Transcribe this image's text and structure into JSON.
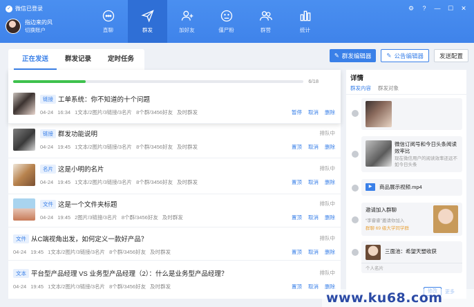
{
  "window": {
    "status": "微信已登录",
    "user_name": "指边来的风",
    "switch_account": "切换账户"
  },
  "nav": [
    {
      "label": "直聊",
      "icon": "chat-icon"
    },
    {
      "label": "群发",
      "icon": "send-icon"
    },
    {
      "label": "加好友",
      "icon": "add-friend-icon"
    },
    {
      "label": "僵尸粉",
      "icon": "zombie-icon"
    },
    {
      "label": "群营",
      "icon": "group-icon"
    },
    {
      "label": "统计",
      "icon": "stats-icon"
    }
  ],
  "tabs": [
    "正在发送",
    "群发记录",
    "定时任务"
  ],
  "header_buttons": {
    "mass_editor": "群发编辑器",
    "notice_editor": "公告编辑器",
    "config": "发送配置"
  },
  "current": {
    "progress_text": "6/18",
    "progress": 0.25,
    "tag": "链接",
    "title": "工单系统：你不知道的十个问题",
    "meta": "04-24 16:34   1文本/2图片/3链接/3名片   8个群/3456好友   及时群发",
    "actions": [
      "暂停",
      "取消",
      "删除"
    ]
  },
  "queue": [
    {
      "tag": "链接",
      "title": "群发功能说明",
      "meta": "04-24 19:45   1文本/2图片/3链接/3名片   8个群/3456好友   及时群发",
      "state": "排队中",
      "actions": [
        "置顶",
        "取消",
        "删除"
      ]
    },
    {
      "tag": "名片",
      "title": "这是小明的名片",
      "meta": "04-24 19:45   1文本/2图片/3链接/3名片   8个群/3456好友   及时群发",
      "state": "排队中",
      "actions": [
        "置顶",
        "取消",
        "删除"
      ]
    },
    {
      "tag": "文件",
      "title": "这是一个文件夹标题",
      "meta": "04-24 19:45   2图片/3链接/3名片   8个群/3456好友   及时群发",
      "state": "排队中",
      "actions": [
        "置顶",
        "取消",
        "删除"
      ]
    },
    {
      "tag": "文件",
      "title": "从C端视角出发，如何定义一款好产品？",
      "meta": "04-24 19:45   1文本/2图片/3链接/3名片   8个群/3456好友   及时群发",
      "state": "排队中",
      "actions": [
        "置顶",
        "取消",
        "删除"
      ]
    },
    {
      "tag": "文本",
      "title": "平台型产品经理 VS 业务型产品经理（2）：什么是业务型产品经理？",
      "meta": "04-24 19:45   1文本/2图片/3链接/3名片   8个群/3456好友   及时群发",
      "state": "排队中",
      "actions": [
        "置顶",
        "取消",
        "删除"
      ]
    }
  ],
  "detail": {
    "title": "详情",
    "tabs": [
      "群发内容",
      "群发对象"
    ],
    "link_card": {
      "title": "微信订阅号和今日头条阅读效率比",
      "desc": "现在微信用户的阅读效率还远不如今日头条"
    },
    "video": "商品展示视频.mp4",
    "invite": {
      "title": "邀请加入群聊",
      "desc": "“李睿睿”邀请你加入",
      "group": "群聊 69 级大学同学群"
    },
    "contact": {
      "name": "三面池：希望天塑收获",
      "label": "个人名片"
    },
    "edit": "修改",
    "more": "更多"
  },
  "watermark": "www.ku68.com"
}
